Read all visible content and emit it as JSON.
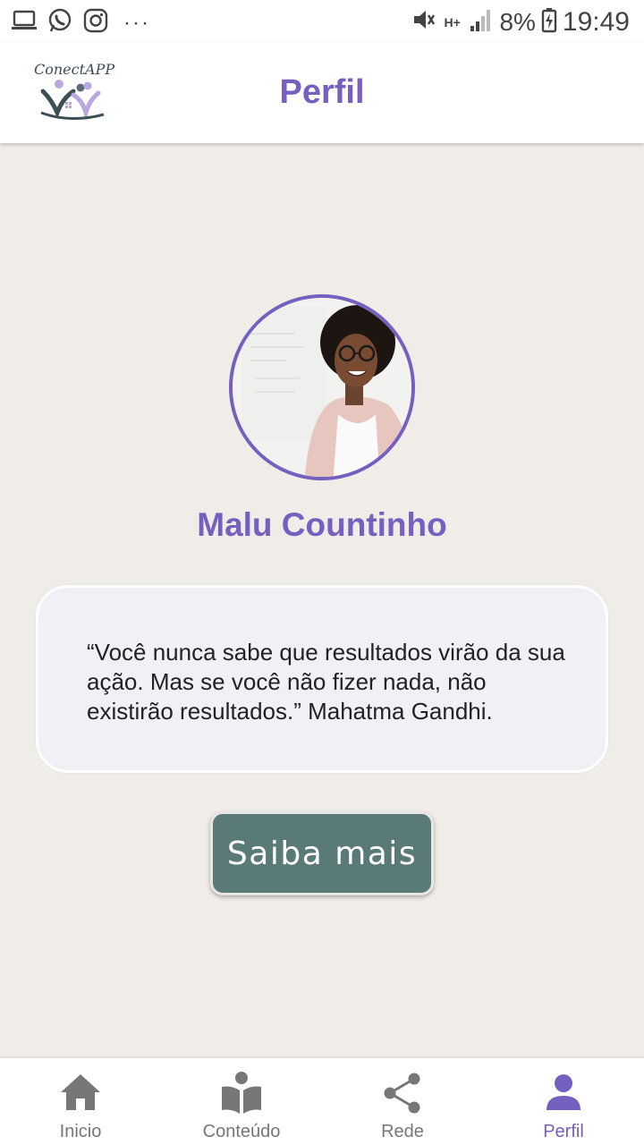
{
  "status_bar": {
    "icons_left": [
      "laptop-icon",
      "whatsapp-icon",
      "instagram-icon",
      "more-dots-icon"
    ],
    "more": "···",
    "network": "H+",
    "battery": "8%",
    "time": "19:49"
  },
  "app_bar": {
    "logo_text": "ConectAPP",
    "title": "Perfil"
  },
  "profile": {
    "name": "Malu Countinho",
    "quote": "“Você nunca sabe que resultados virão da sua ação. Mas se você não fizer nada, não existirão resultados.” Mahatma Gandhi.",
    "button_label": "Saiba mais"
  },
  "nav": {
    "items": [
      {
        "label": "Inicio",
        "icon": "home-icon"
      },
      {
        "label": "Conteúdo",
        "icon": "book-reader-icon"
      },
      {
        "label": "Rede",
        "icon": "share-icon"
      },
      {
        "label": "Perfil",
        "icon": "person-icon"
      }
    ],
    "active_index": 3
  },
  "colors": {
    "accent": "#7560c0",
    "button": "#5a7a78",
    "background": "#f0ece8",
    "card": "#f0f1f6"
  }
}
